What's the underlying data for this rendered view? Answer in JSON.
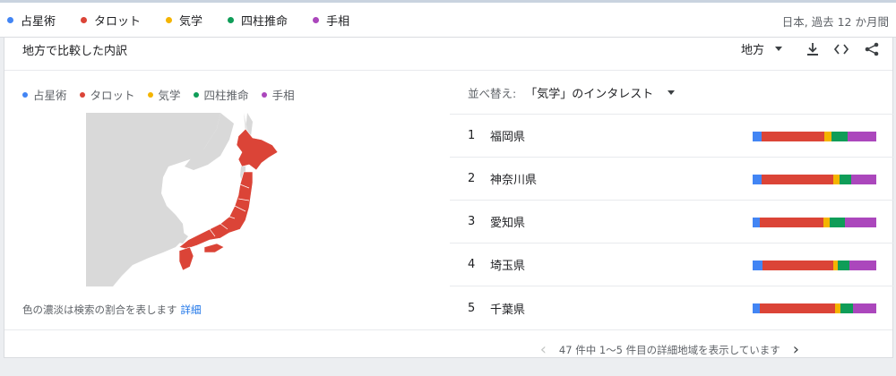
{
  "series": [
    {
      "name": "占星術",
      "color": "#4285f4"
    },
    {
      "name": "タロット",
      "color": "#db4437"
    },
    {
      "name": "気学",
      "color": "#f4b400"
    },
    {
      "name": "四柱推命",
      "color": "#0f9d58"
    },
    {
      "name": "手相",
      "color": "#ab47bc"
    }
  ],
  "header": {
    "range": "日本, 過去 12 か月間"
  },
  "card": {
    "title": "地方で比較した内訳",
    "region_select": "地方",
    "note": "色の濃淡は検索の割合を表します",
    "note_link": "詳細"
  },
  "sort": {
    "label": "並べ替え:",
    "value": "「気学」のインタレスト"
  },
  "rows": [
    {
      "rank": "1",
      "name": "福岡県",
      "shares": [
        0.07,
        0.51,
        0.06,
        0.13,
        0.23
      ]
    },
    {
      "rank": "2",
      "name": "神奈川県",
      "shares": [
        0.07,
        0.58,
        0.05,
        0.1,
        0.2
      ]
    },
    {
      "rank": "3",
      "name": "愛知県",
      "shares": [
        0.06,
        0.51,
        0.05,
        0.13,
        0.25
      ]
    },
    {
      "rank": "4",
      "name": "埼玉県",
      "shares": [
        0.08,
        0.57,
        0.04,
        0.09,
        0.22
      ]
    },
    {
      "rank": "5",
      "name": "千葉県",
      "shares": [
        0.06,
        0.61,
        0.04,
        0.1,
        0.19
      ]
    }
  ],
  "pager": {
    "text": "47 件中 1〜5 件目の詳細地域を表示しています"
  },
  "icons": [
    "download-icon",
    "embed-code-icon",
    "share-icon",
    "chevron-left-icon",
    "chevron-right-icon",
    "dropdown-caret-icon"
  ]
}
